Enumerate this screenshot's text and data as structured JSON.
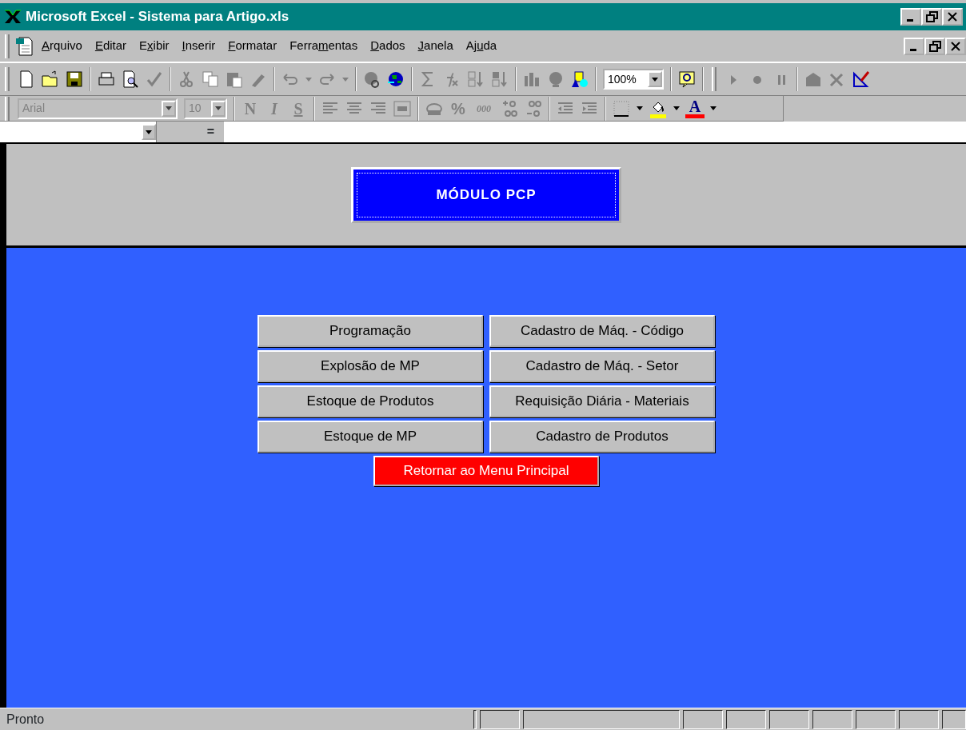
{
  "window": {
    "title": "Microsoft Excel - Sistema para Artigo.xls"
  },
  "menu": [
    {
      "key": "A",
      "after": "rquivo"
    },
    {
      "key": "E",
      "after": "ditar"
    },
    {
      "before": "E",
      "key": "x",
      "after": "ibir"
    },
    {
      "key": "I",
      "after": "nserir"
    },
    {
      "key": "F",
      "after": "ormatar"
    },
    {
      "before": "Ferra",
      "key": "m",
      "after": "entas"
    },
    {
      "key": "D",
      "after": "ados"
    },
    {
      "key": "J",
      "after": "anela"
    },
    {
      "before": "Aj",
      "key": "u",
      "after": "da"
    }
  ],
  "standard_toolbar": {
    "zoom": "100%"
  },
  "formatting_toolbar": {
    "font": {
      "value": "Arial",
      "disabled": true
    },
    "size": {
      "value": "10",
      "disabled": true
    },
    "glyphs": [
      {
        "text": "N",
        "kind": "bold"
      },
      {
        "text": "I",
        "kind": "italic"
      },
      {
        "text": "S",
        "kind": "underline"
      }
    ],
    "percent": "%",
    "thousands": "000",
    "font_color": {
      "text": "A",
      "color": "#ff0000"
    },
    "fill": {
      "color": "#ffff00"
    }
  },
  "formula_bar": {
    "equals": "="
  },
  "sheet": {
    "header_button": "MÓDULO PCP",
    "buttons": [
      {
        "label": "Programação",
        "kind": "normal"
      },
      {
        "label": "Cadastro de Máq. - Código",
        "kind": "normal"
      },
      {
        "label": "Explosão de MP",
        "kind": "normal"
      },
      {
        "label": "Cadastro de Máq. - Setor",
        "kind": "normal"
      },
      {
        "label": "Estoque de Produtos",
        "kind": "normal"
      },
      {
        "label": "Requisição Diária - Materiais",
        "kind": "normal"
      },
      {
        "label": "Estoque de MP",
        "kind": "normal"
      },
      {
        "label": "Cadastro de Produtos",
        "kind": "normal"
      },
      {
        "label": "Retornar ao Menu Principal",
        "kind": "return"
      }
    ]
  },
  "status_bar": {
    "text": "Pronto"
  }
}
